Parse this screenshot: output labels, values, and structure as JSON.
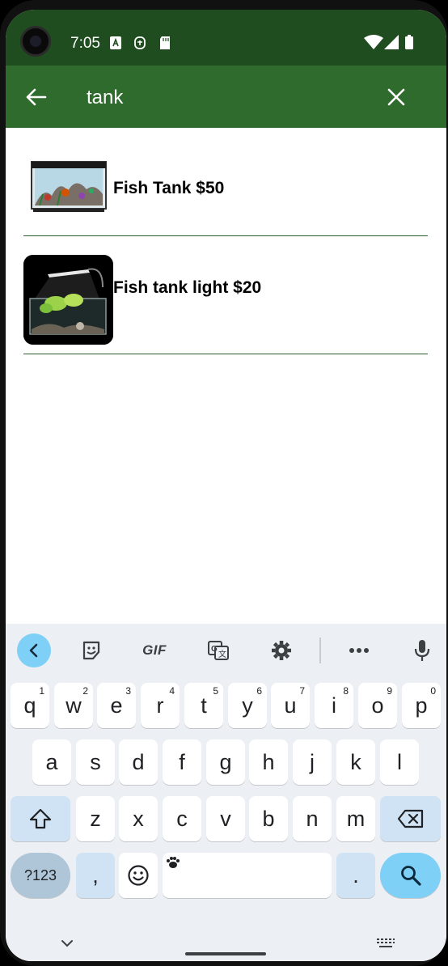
{
  "status_bar": {
    "time": "7:05"
  },
  "search": {
    "query": "tank",
    "back_icon": "arrow-left-icon",
    "clear_icon": "close-icon"
  },
  "results": [
    {
      "label": "Fish Tank $50",
      "image": "fish-tank-image"
    },
    {
      "label": "Fish tank light $20",
      "image": "fish-tank-light-image"
    }
  ],
  "keyboard": {
    "row1": [
      "q",
      "w",
      "e",
      "r",
      "t",
      "y",
      "u",
      "i",
      "o",
      "p"
    ],
    "row1_hints": [
      "1",
      "2",
      "3",
      "4",
      "5",
      "6",
      "7",
      "8",
      "9",
      "0"
    ],
    "row2": [
      "a",
      "s",
      "d",
      "f",
      "g",
      "h",
      "j",
      "k",
      "l"
    ],
    "row3": [
      "z",
      "x",
      "c",
      "v",
      "b",
      "n",
      "m"
    ],
    "symbols_label": "?123",
    "comma": ",",
    "period": ".",
    "gif_label": "GIF"
  },
  "colors": {
    "status_bar": "#1f4d1f",
    "app_bar": "#2e6b2d",
    "accent": "#7fd0f7"
  }
}
